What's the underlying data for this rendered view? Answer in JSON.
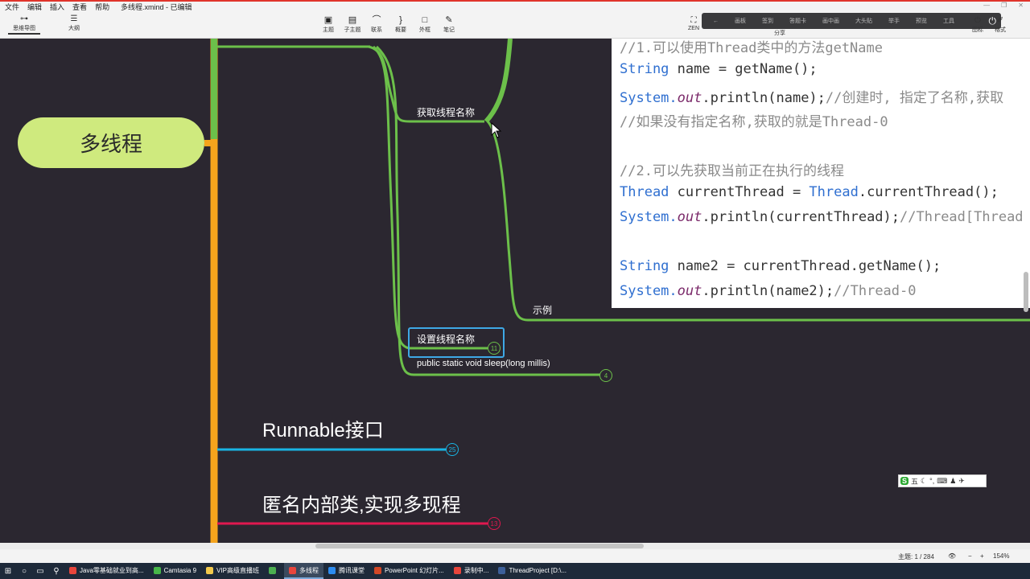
{
  "window": {
    "menu": [
      "文件",
      "编辑",
      "插入",
      "查看",
      "帮助"
    ],
    "title": "多线程.xmind - 已编辑"
  },
  "viewtabs": [
    {
      "label": "思维导图",
      "icon": "mindmap-icon"
    },
    {
      "label": "大纲",
      "icon": "outline-icon"
    }
  ],
  "toolbar": [
    {
      "label": "主题",
      "icon": "topic-icon"
    },
    {
      "label": "子主题",
      "icon": "subtopic-icon"
    },
    {
      "label": "联系",
      "icon": "relationship-icon"
    },
    {
      "label": "概要",
      "icon": "summary-icon"
    },
    {
      "label": "外框",
      "icon": "boundary-icon"
    },
    {
      "label": "笔记",
      "icon": "note-icon"
    }
  ],
  "zen_label": "ZEN",
  "ribbon": [
    "画板",
    "签到",
    "答题卡",
    "画中画",
    "大头贴",
    "举手",
    "预览",
    "工具"
  ],
  "share_label": "分享",
  "right_buttons": [
    {
      "label": "图标",
      "icon": "power-icon"
    },
    {
      "label": "格式",
      "icon": "brush-icon"
    }
  ],
  "mindmap": {
    "root": "多线程",
    "nodes": {
      "get_name": "获取线程名称",
      "example": "示例",
      "set_name": "设置线程名称",
      "sleep": "public static void sleep(long millis)",
      "runnable": "Runnable接口",
      "anonymous": "匿名内部类,实现多现程"
    },
    "counts": {
      "set_name": "11",
      "sleep": "4",
      "runnable": "25",
      "anonymous": "13"
    },
    "colors": {
      "green": "#6cc04a",
      "orange": "#f5a41c",
      "blue": "#19b4e3",
      "red": "#e0184f",
      "root_fill": "#cfea7e"
    }
  },
  "code_lines": [
    {
      "parts": [
        {
          "t": "//1.可以使用Thread类中的方法getName",
          "c": "c-com"
        }
      ]
    },
    {
      "parts": [
        {
          "t": "String",
          "c": "c-type"
        },
        {
          "t": " name = getName();",
          "c": "c-meth"
        }
      ]
    },
    {
      "parts": [
        {
          "t": "System.",
          "c": "c-type"
        },
        {
          "t": "out",
          "c": "c-out"
        },
        {
          "t": ".println(name);",
          "c": "c-meth"
        },
        {
          "t": "//创建时, 指定了名称,获取",
          "c": "c-com"
        }
      ]
    },
    {
      "parts": [
        {
          "t": "//如果没有指定名称,获取的就是Thread-0",
          "c": "c-com"
        }
      ]
    },
    {
      "parts": [
        {
          "t": "//2.可以先获取当前正在执行的线程",
          "c": "c-com"
        }
      ]
    },
    {
      "parts": [
        {
          "t": "Thread",
          "c": "c-type"
        },
        {
          "t": " currentThread = ",
          "c": "c-meth"
        },
        {
          "t": "Thread",
          "c": "c-type"
        },
        {
          "t": ".currentThread();",
          "c": "c-meth"
        }
      ]
    },
    {
      "parts": [
        {
          "t": "System.",
          "c": "c-type"
        },
        {
          "t": "out",
          "c": "c-out"
        },
        {
          "t": ".println(currentThread);",
          "c": "c-meth"
        },
        {
          "t": "//Thread[Thread",
          "c": "c-com"
        }
      ]
    },
    {
      "parts": [
        {
          "t": "String",
          "c": "c-type"
        },
        {
          "t": " name2 = currentThread.getName();",
          "c": "c-meth"
        }
      ]
    },
    {
      "parts": [
        {
          "t": "System.",
          "c": "c-type"
        },
        {
          "t": "out",
          "c": "c-out"
        },
        {
          "t": ".println(name2);",
          "c": "c-meth"
        },
        {
          "t": "//Thread-0",
          "c": "c-com"
        }
      ]
    }
  ],
  "ime": {
    "label": "五",
    "icons": [
      "moon-icon",
      "punct-icon",
      "keyboard-icon",
      "user-icon",
      "wrench-icon"
    ]
  },
  "status": {
    "topics": "主题: 1 / 284",
    "zoom": "154%",
    "zoom_minus": "−",
    "zoom_plus": "+"
  },
  "taskbar": {
    "items": [
      {
        "label": "Java零基础就业到高...",
        "color": "#e8453c"
      },
      {
        "label": "Camtasia 9",
        "color": "#47b649"
      },
      {
        "label": "VIP高级直播班",
        "color": "#f2c94c"
      },
      {
        "label": "",
        "color": "#4caf50"
      },
      {
        "label": "多线程",
        "color": "#e8453c",
        "active": true
      },
      {
        "label": "腾讯课堂",
        "color": "#2d8cf0"
      },
      {
        "label": "PowerPoint 幻灯片...",
        "color": "#d24726"
      },
      {
        "label": "录制中...",
        "color": "#e8453c"
      },
      {
        "label": "ThreadProject [D:\\...",
        "color": "#3c5f9a"
      }
    ]
  }
}
